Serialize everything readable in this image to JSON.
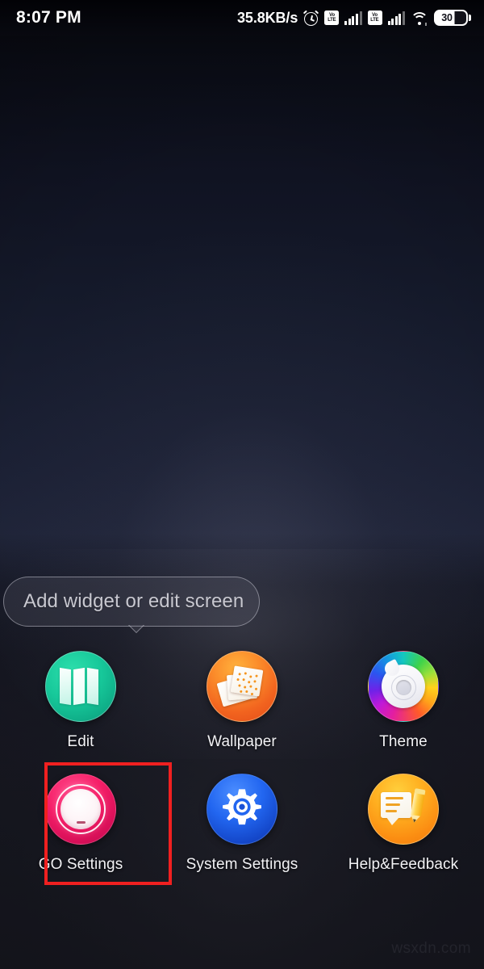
{
  "statusbar": {
    "time": "8:07 PM",
    "network_speed": "35.8KB/s",
    "alarm_icon": "alarm-clock-icon",
    "sim1_volte_top": "Vo",
    "sim1_volte_bottom": "LTE",
    "sim2_volte_top": "Vo",
    "sim2_volte_bottom": "LTE",
    "signal1_icon": "signal-bars-icon",
    "signal2_icon": "signal-bars-icon",
    "wifi_icon": "wifi-icon",
    "battery_level": "30"
  },
  "tooltip": {
    "text": "Add widget or edit screen"
  },
  "menu": {
    "items": [
      {
        "id": "edit",
        "label": "Edit",
        "icon": "book-pages-icon",
        "color": "#17c89a"
      },
      {
        "id": "wallpaper",
        "label": "Wallpaper",
        "icon": "paper-sheets-icon",
        "color": "#f2641f"
      },
      {
        "id": "theme",
        "label": "Theme",
        "icon": "color-wheel-icon",
        "color": "#e31ea0"
      },
      {
        "id": "go-settings",
        "label": "GO Settings",
        "icon": "go-launcher-icon",
        "color": "#f51f68"
      },
      {
        "id": "system-settings",
        "label": "System Settings",
        "icon": "gear-icon",
        "color": "#2266f0"
      },
      {
        "id": "help-feedback",
        "label": "Help&Feedback",
        "icon": "speech-pencil-icon",
        "color": "#ffae1f"
      }
    ]
  },
  "highlight": {
    "target": "GO Settings",
    "color": "#f02020"
  },
  "watermark": {
    "text": "wsxdn.com"
  }
}
